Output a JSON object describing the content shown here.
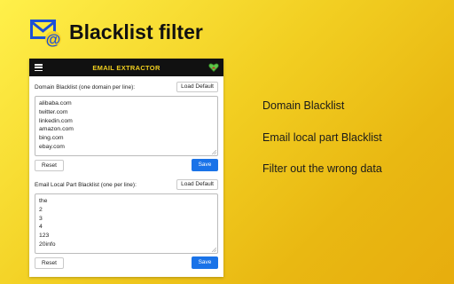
{
  "page": {
    "title": "Blacklist filter"
  },
  "panel": {
    "header_title": "EMAIL EXTRACTOR",
    "domain": {
      "label": "Domain Blacklist (one domain per line):",
      "load_default": "Load Default",
      "lines": [
        "alibaba.com",
        "twitter.com",
        "linkedin.com",
        "amazon.com",
        "bing.com",
        "ebay.com"
      ],
      "reset": "Reset",
      "save": "Save"
    },
    "local": {
      "label": "Email Local Part Blacklist (one per line):",
      "load_default": "Load Default",
      "lines": [
        "the",
        "2",
        "3",
        "4",
        "123",
        "20info"
      ],
      "reset": "Reset",
      "save": "Save"
    }
  },
  "features": [
    "Domain Blacklist",
    "Email local part Blacklist",
    "Filter out the wrong data"
  ],
  "colors": {
    "accent": "#1a73e8",
    "header_bg": "#111111",
    "header_text": "#f2d01f",
    "heart": "#5cc84a"
  },
  "icons": {
    "logo": "email-at-icon",
    "menu": "hamburger-menu-icon",
    "heart": "heart-icon"
  }
}
